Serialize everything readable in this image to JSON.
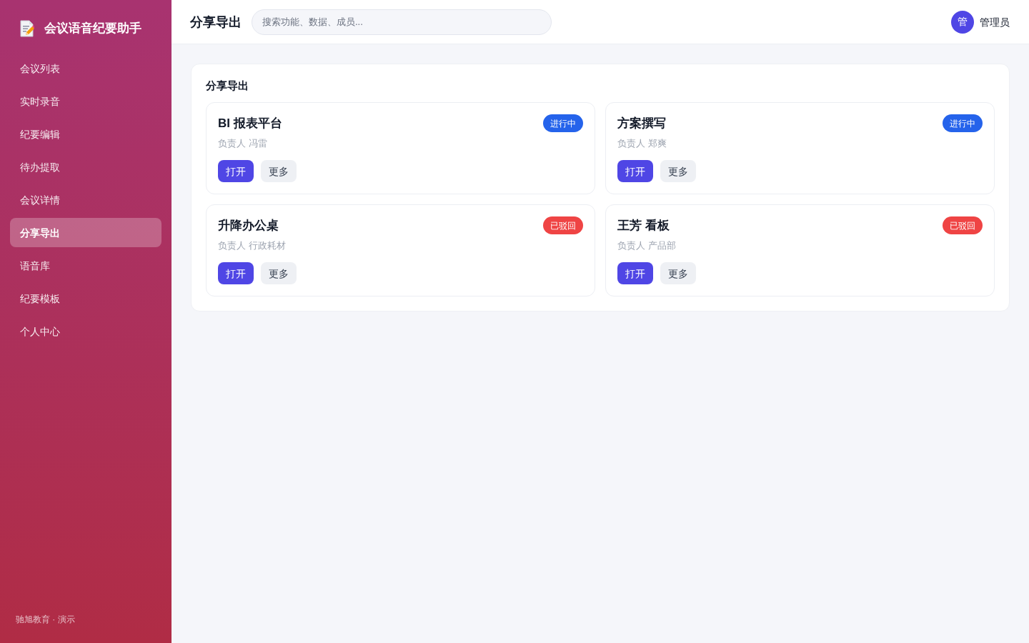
{
  "app": {
    "title": "会议语音纪要助手"
  },
  "sidebar": {
    "items": [
      {
        "label": "会议列表",
        "selected": false
      },
      {
        "label": "实时录音",
        "selected": false
      },
      {
        "label": "纪要编辑",
        "selected": false
      },
      {
        "label": "待办提取",
        "selected": false
      },
      {
        "label": "会议详情",
        "selected": false
      },
      {
        "label": "分享导出",
        "selected": true
      },
      {
        "label": "语音库",
        "selected": false
      },
      {
        "label": "纪要模板",
        "selected": false
      },
      {
        "label": "个人中心",
        "selected": false
      }
    ],
    "footer": "驰旭教育 · 演示"
  },
  "header": {
    "title": "分享导出",
    "search": {
      "placeholder": "搜索功能、数据、成员..."
    },
    "user": {
      "avatar": "管",
      "name": "管理员"
    }
  },
  "panel": {
    "title": "分享导出",
    "cards": [
      {
        "title": "BI 报表平台",
        "owner": "负责人 冯雷",
        "status": "进行中",
        "color": "#2563eb",
        "actions": [
          {
            "label": "打开",
            "kind": "primary"
          },
          {
            "label": "更多",
            "kind": "secondary"
          }
        ]
      },
      {
        "title": "方案撰写",
        "owner": "负责人 郑爽",
        "status": "进行中",
        "color": "#2563eb",
        "actions": [
          {
            "label": "打开",
            "kind": "primary"
          },
          {
            "label": "更多",
            "kind": "secondary"
          }
        ]
      },
      {
        "title": "升降办公桌",
        "owner": "负责人 行政耗材",
        "status": "已驳回",
        "color": "#ef4444",
        "actions": [
          {
            "label": "打开",
            "kind": "primary"
          },
          {
            "label": "更多",
            "kind": "secondary"
          }
        ]
      },
      {
        "title": "王芳 看板",
        "owner": "负责人 产品部",
        "status": "已驳回",
        "color": "#ef4444",
        "actions": [
          {
            "label": "打开",
            "kind": "primary"
          },
          {
            "label": "更多",
            "kind": "secondary"
          }
        ]
      }
    ]
  }
}
